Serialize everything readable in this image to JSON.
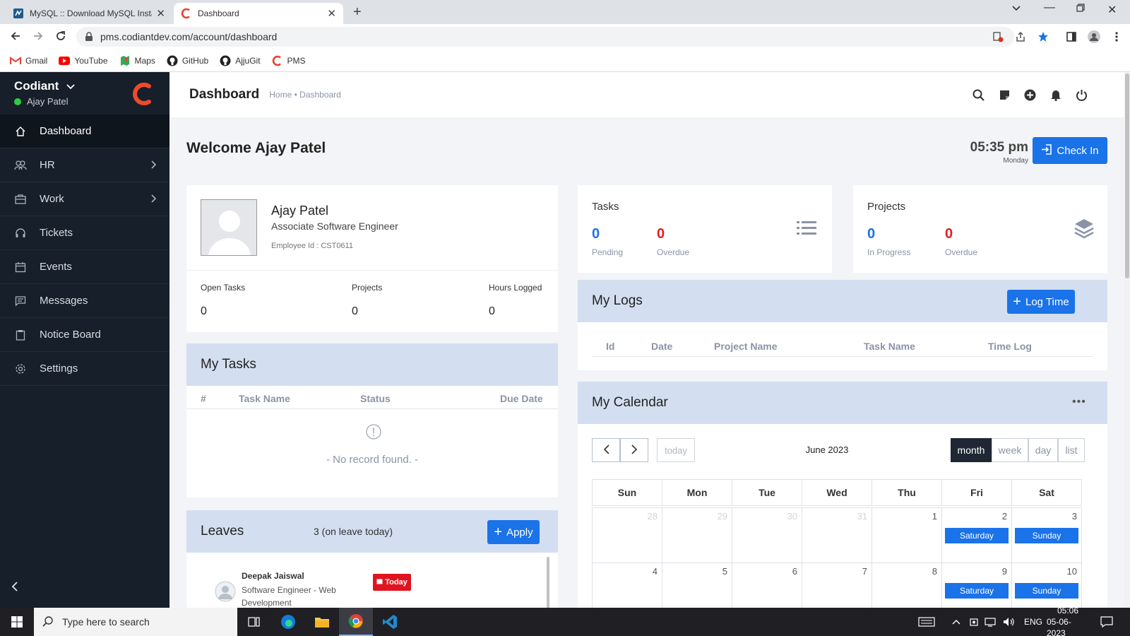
{
  "browser": {
    "tabs": [
      {
        "title": "MySQL :: Download MySQL Insta",
        "active": false
      },
      {
        "title": "Dashboard",
        "active": true
      }
    ],
    "url": "pms.codiantdev.com/account/dashboard",
    "bookmarks": [
      {
        "label": "Gmail",
        "icon": "gmail-icon"
      },
      {
        "label": "YouTube",
        "icon": "youtube-icon"
      },
      {
        "label": "Maps",
        "icon": "maps-icon"
      },
      {
        "label": "GitHub",
        "icon": "github-icon"
      },
      {
        "label": "AjjuGit",
        "icon": "github-icon"
      },
      {
        "label": "PMS",
        "icon": "codiant-icon"
      }
    ]
  },
  "sidebar": {
    "brand": "Codiant",
    "user": "Ajay Patel",
    "items": [
      {
        "label": "Dashboard",
        "icon": "home-icon",
        "active": true
      },
      {
        "label": "HR",
        "icon": "users-icon",
        "has_children": true
      },
      {
        "label": "Work",
        "icon": "briefcase-icon",
        "has_children": true
      },
      {
        "label": "Tickets",
        "icon": "headset-icon"
      },
      {
        "label": "Events",
        "icon": "calendar-icon"
      },
      {
        "label": "Messages",
        "icon": "message-icon"
      },
      {
        "label": "Notice Board",
        "icon": "clipboard-icon"
      },
      {
        "label": "Settings",
        "icon": "gear-icon"
      }
    ]
  },
  "header": {
    "title": "Dashboard",
    "breadcrumb": "Home • Dashboard"
  },
  "welcome": "Welcome Ajay Patel",
  "clock": {
    "time": "05:35 pm",
    "day": "Monday"
  },
  "check_in_label": "Check In",
  "profile": {
    "name": "Ajay Patel",
    "role": "Associate Software Engineer",
    "employee_id": "Employee Id : CST0611",
    "stats": [
      {
        "label": "Open Tasks",
        "value": "0"
      },
      {
        "label": "Projects",
        "value": "0"
      },
      {
        "label": "Hours Logged",
        "value": "0"
      }
    ]
  },
  "tasks_card": {
    "title": "Tasks",
    "pending": {
      "value": "0",
      "label": "Pending"
    },
    "overdue": {
      "value": "0",
      "label": "Overdue"
    }
  },
  "projects_card": {
    "title": "Projects",
    "in_progress": {
      "value": "0",
      "label": "In Progress"
    },
    "overdue": {
      "value": "0",
      "label": "Overdue"
    }
  },
  "my_logs": {
    "title": "My Logs",
    "button": "Log Time",
    "columns": [
      "Id",
      "Date",
      "Project Name",
      "Task Name",
      "Time Log"
    ]
  },
  "my_tasks": {
    "title": "My Tasks",
    "columns": [
      "#",
      "Task Name",
      "Status",
      "Due Date"
    ],
    "empty": "- No record found. -"
  },
  "my_calendar": {
    "title": "My Calendar",
    "today_btn": "today",
    "month_label": "June 2023",
    "views": [
      "month",
      "week",
      "day",
      "list"
    ],
    "active_view": "month",
    "weekdays": [
      "Sun",
      "Mon",
      "Tue",
      "Wed",
      "Thu",
      "Fri",
      "Sat"
    ],
    "weeks": [
      [
        {
          "d": "28",
          "other": true
        },
        {
          "d": "29",
          "other": true
        },
        {
          "d": "30",
          "other": true
        },
        {
          "d": "31",
          "other": true
        },
        {
          "d": "1"
        },
        {
          "d": "2",
          "event": "Saturday"
        },
        {
          "d": "3",
          "event": "Sunday"
        }
      ],
      [
        {
          "d": "4"
        },
        {
          "d": "5"
        },
        {
          "d": "6"
        },
        {
          "d": "7"
        },
        {
          "d": "8"
        },
        {
          "d": "9",
          "event": "Saturday"
        },
        {
          "d": "10",
          "event": "Sunday"
        }
      ]
    ],
    "event_color": "#1a73e8"
  },
  "leaves": {
    "title": "Leaves",
    "count_text": "3 (on leave today)",
    "button": "Apply",
    "entries": [
      {
        "name": "Deepak Jaiswal",
        "role": "Software Engineer - Web",
        "role_cont": "Development",
        "badge": "Today"
      }
    ]
  },
  "taskbar": {
    "search_placeholder": "Type here to search",
    "lang": "ENG",
    "time": "05:06",
    "date": "05-06-2023"
  },
  "colors": {
    "primary": "#1a73e8",
    "danger": "#e02020",
    "sidebar": "#171f2a",
    "panel_head": "#d3dff0"
  }
}
